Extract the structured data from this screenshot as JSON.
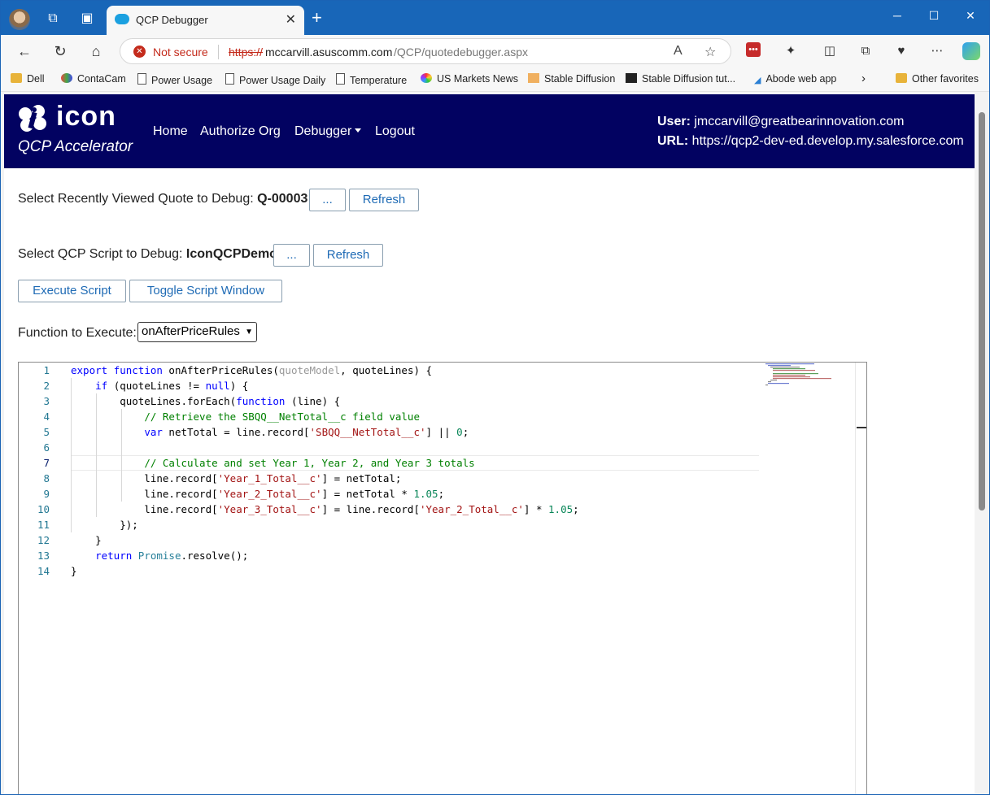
{
  "browser": {
    "tab_title": "QCP Debugger",
    "not_secure": "Not secure",
    "url_protocol": "https://",
    "url_host": "mccarvill.asuscomm.com",
    "url_path": "/QCP/quotedebugger.aspx",
    "favorites": [
      "Dell",
      "ContaCam",
      "Power Usage",
      "Power Usage Daily",
      "Temperature",
      "US Markets News",
      "Stable Diffusion",
      "Stable Diffusion tut...",
      "Abode web app"
    ],
    "other_favorites": "Other favorites",
    "colors": {
      "tabbar": "#1866b8",
      "not_secure": "#c42b1c"
    }
  },
  "app": {
    "logo_word": "icon",
    "logo_subtitle": "QCP Accelerator",
    "nav": {
      "home": "Home",
      "authorize": "Authorize Org",
      "debugger": "Debugger",
      "logout": "Logout"
    },
    "user_label": "User:",
    "user_value": "jmccarvill@greatbearinnovation.com",
    "url_label": "URL:",
    "url_value": "https://qcp2-dev-ed.develop.my.salesforce.com",
    "header_color": "#020261"
  },
  "form": {
    "quote_label": "Select Recently Viewed Quote to Debug:",
    "quote_value": "Q-00003",
    "ellipsis": "...",
    "refresh": "Refresh",
    "script_label": "Select QCP Script to Debug:",
    "script_value": "IconQCPDemo",
    "execute": "Execute Script",
    "toggle": "Toggle Script Window",
    "function_label": "Function to Execute:",
    "function_value": "onAfterPriceRules"
  },
  "editor": {
    "line_numbers": [
      "1",
      "2",
      "3",
      "4",
      "5",
      "6",
      "7",
      "8",
      "9",
      "10",
      "11",
      "12",
      "13",
      "14"
    ]
  }
}
